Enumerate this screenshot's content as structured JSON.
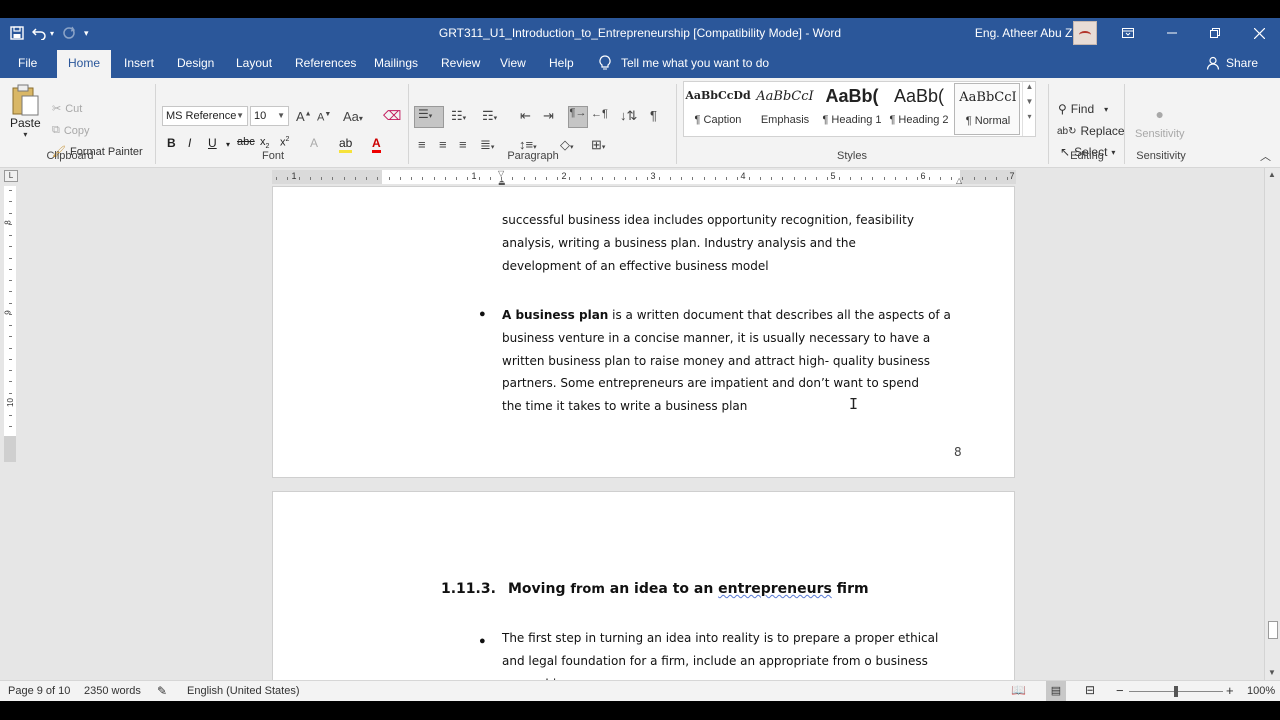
{
  "title_bar": {
    "title": "GRT311_U1_Introduction_to_Entrepreneurship [Compatibility Mode]  -  Word",
    "user_name": "Eng. Atheer Abu Znaid"
  },
  "tabs": [
    "File",
    "Home",
    "Insert",
    "Design",
    "Layout",
    "References",
    "Mailings",
    "Review",
    "View",
    "Help"
  ],
  "tell_me": "Tell me what you want to do",
  "share": "Share",
  "clipboard": {
    "paste": "Paste",
    "cut": "Cut",
    "copy": "Copy",
    "format_painter": "Format Painter",
    "label": "Clipboard"
  },
  "font": {
    "name": "MS Reference",
    "size": "10",
    "case_label": "Aa",
    "label": "Font"
  },
  "paragraph": {
    "label": "Paragraph"
  },
  "styles": {
    "label": "Styles",
    "items": [
      {
        "preview": "AaBbCcDd",
        "name": "¶ Caption"
      },
      {
        "preview": "AaBbCcI",
        "name": "Emphasis"
      },
      {
        "preview": "AaBb(",
        "name": "¶ Heading 1"
      },
      {
        "preview": "AaBb(",
        "name": "¶ Heading 2"
      },
      {
        "preview": "AaBbCcI",
        "name": "¶ Normal"
      }
    ]
  },
  "editing": {
    "find": "Find",
    "replace": "Replace",
    "select": "Select",
    "label": "Editing"
  },
  "sensitivity": {
    "button": "Sensitivity",
    "label": "Sensitivity"
  },
  "ruler": {
    "h_numbers": [
      "1",
      "1",
      "2",
      "3",
      "4",
      "5",
      "6",
      "7"
    ],
    "v_numbers": [
      "8",
      "9",
      "10"
    ]
  },
  "document": {
    "page1_lines": [
      "successful business idea includes opportunity recognition, feasibility",
      "analysis, writing a business plan.   Industry analysis and the",
      "development of an effective business model"
    ],
    "bullet_bold": "A business plan",
    "bullet1_first_rest": " is a written document that describes all the aspects of a",
    "bullet1_lines": [
      "business venture in a concise manner, it is usually necessary to have a",
      "written business plan to raise money and attract high- quality business",
      "partners.  Some entrepreneurs are impatient and don’t want to spend",
      "the time it takes to write a business plan"
    ],
    "page_number": "8",
    "heading_number": "1.11.3.",
    "heading_text_a": "Moving ",
    "heading_text_b": "from",
    "heading_text_c": " an idea to an ",
    "heading_text_d": "entrepreneurs",
    "heading_text_e": " firm",
    "bullet2_lines": [
      "The first step in turning an idea into reality is to prepare a proper ethical",
      "and legal foundation for a firm, include an appropriate from o business",
      "ownership"
    ]
  },
  "status_bar": {
    "page": "Page 9 of 10",
    "words": "2350 words",
    "language": "English (United States)",
    "zoom": "100%"
  }
}
